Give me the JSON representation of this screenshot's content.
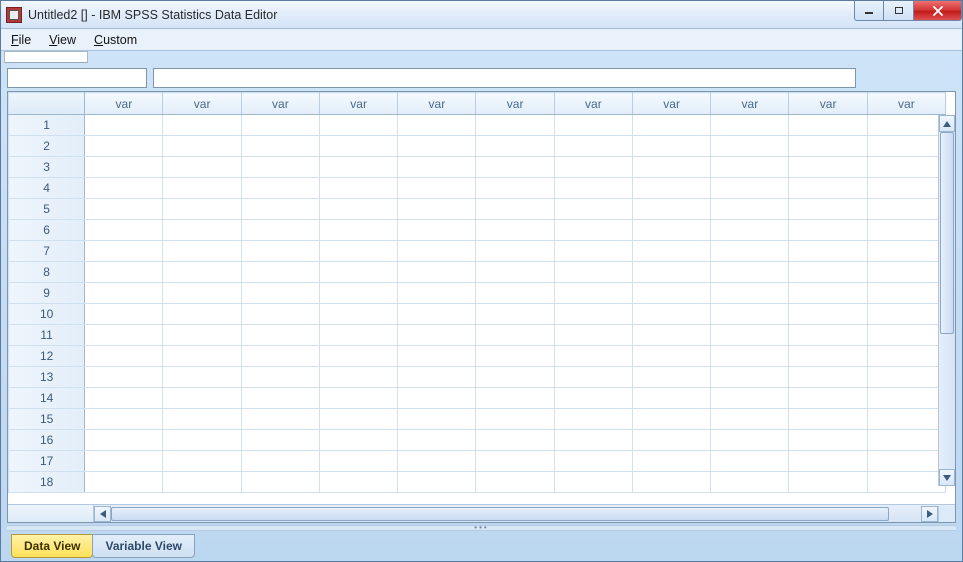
{
  "window": {
    "title": "Untitled2 [] - IBM SPSS Statistics Data Editor"
  },
  "menu": {
    "file": "File",
    "view": "View",
    "custom": "Custom"
  },
  "grid": {
    "col_header": "var",
    "num_cols": 11,
    "num_rows": 18
  },
  "tabs": {
    "data_view": "Data View",
    "variable_view": "Variable View"
  },
  "icons": {
    "app": "spss-app-icon",
    "min": "minimize-icon",
    "max": "maximize-icon",
    "close": "close-icon"
  }
}
